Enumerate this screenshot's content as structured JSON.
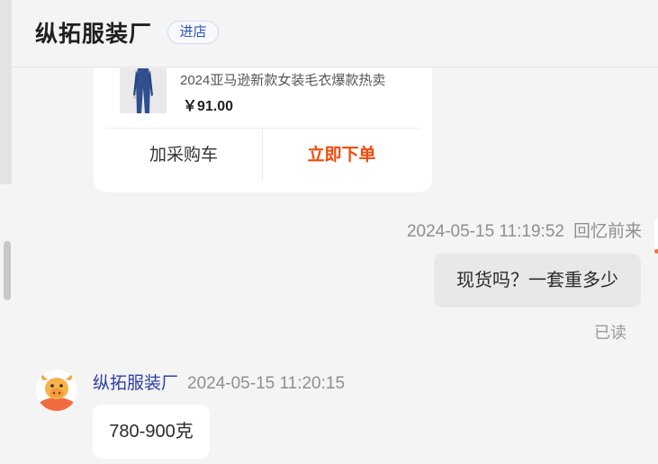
{
  "header": {
    "shop_name": "纵拓服装厂",
    "enter_label": "进店"
  },
  "product": {
    "title": "2024亚马逊新款女装毛衣爆款热卖",
    "price": "￥91.00",
    "add_to_cart_label": "加采购车",
    "buy_now_label": "立即下单"
  },
  "my_message": {
    "timestamp": "2024-05-15 11:19:52",
    "sender": "回忆前来",
    "text": "现货吗？一套重多少",
    "status": "已读"
  },
  "their_message": {
    "sender": "纵拓服装厂",
    "timestamp": "2024-05-15 11:20:15",
    "text": "780-900克"
  },
  "colors": {
    "accent_buy": "#f04a0c",
    "sender_name": "#2d3ea7",
    "enter_text": "#2c55b8"
  }
}
